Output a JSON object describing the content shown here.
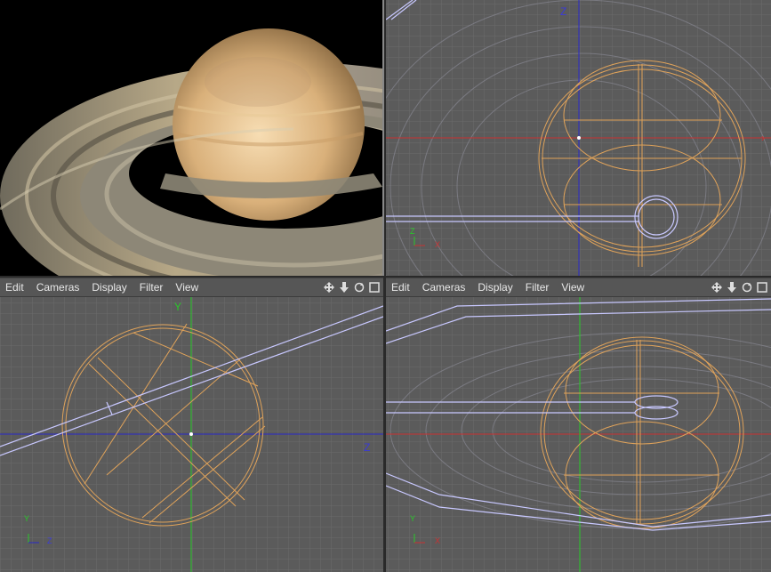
{
  "menus": {
    "left": [
      "Edit",
      "Cameras",
      "Display",
      "Filter",
      "View"
    ],
    "right": [
      "Edit",
      "Cameras",
      "Display",
      "Filter",
      "View"
    ]
  },
  "viewports": {
    "front": {
      "axis_v": "Z",
      "corner_axes": [
        "Z",
        "X"
      ]
    },
    "side": {
      "axis_v": "Y",
      "axis_h": "Z",
      "corner_axes": [
        "Y",
        "Z"
      ]
    },
    "top": {
      "corner_axes": [
        "Y",
        "X"
      ]
    }
  },
  "icons": [
    "move-icon",
    "down-arrow-icon",
    "rotate-icon",
    "maximize-icon"
  ],
  "colors": {
    "viewport_bg": "#5b5b5b",
    "grid": "#6a6a6a",
    "wire_orange": "#e0a35a",
    "wire_blue": "#c8c8ff",
    "axis_red": "#c83232",
    "axis_blue": "#2828c8",
    "axis_green": "#28c828"
  }
}
